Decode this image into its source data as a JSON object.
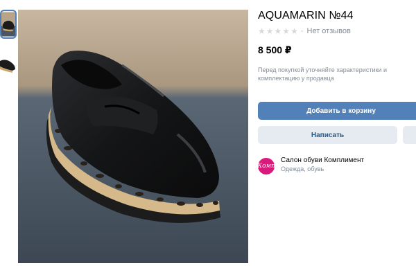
{
  "gallery": {
    "thumbnails": [
      {
        "alt": "shoe-photo-1",
        "active": true
      },
      {
        "alt": "shoe-photo-2",
        "active": false
      }
    ],
    "main_image_alt": "black-leather-loafer-leopard-sole"
  },
  "product": {
    "title": "AQUAMARIN №44",
    "rating_stars": 0,
    "rating_max": 5,
    "rating_separator": "·",
    "reviews_text": "Нет отзывов",
    "price": "8 500 ₽",
    "note": "Перед покупкой уточняйте характеристики и комплектацию у продавца"
  },
  "actions": {
    "add_to_cart": "Добавить в корзину",
    "write": "Написать"
  },
  "seller": {
    "name": "Салон обуви Комплимент",
    "category": "Одежда, обувь",
    "avatar_text": "Комп"
  },
  "colors": {
    "accent": "#5181b8",
    "secondary_bg": "#e5ebf1",
    "secondary_text": "#2a5885",
    "muted": "#818c99",
    "avatar": "#d81b7b"
  }
}
